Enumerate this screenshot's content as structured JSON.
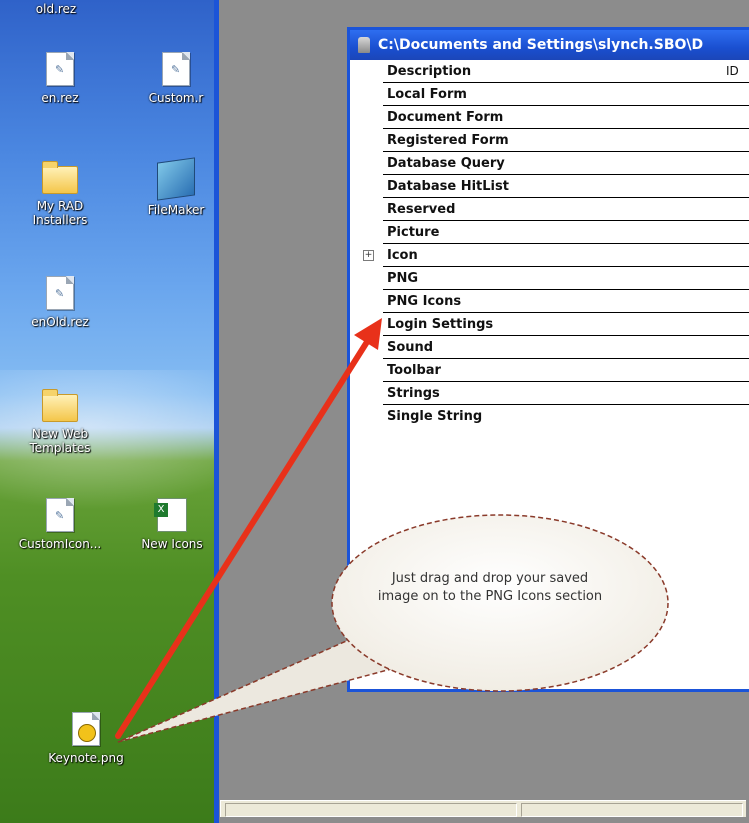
{
  "desktop": {
    "icons": [
      {
        "label": "old.rez",
        "type": "file"
      },
      {
        "label": "en.rez",
        "type": "file"
      },
      {
        "label": "Custom.r",
        "type": "file"
      },
      {
        "label": "My RAD\nInstallers",
        "type": "folder"
      },
      {
        "label": "FileMaker",
        "type": "shortcut"
      },
      {
        "label": "enOld.rez",
        "type": "file"
      },
      {
        "label": "New Web\nTemplates",
        "type": "folder"
      },
      {
        "label": "CustomIcon...",
        "type": "file"
      },
      {
        "label": "New Icons",
        "type": "excel"
      },
      {
        "label": "Keynote.png",
        "type": "png"
      }
    ]
  },
  "window": {
    "title": "C:\\Documents and Settings\\slynch.SBO\\D",
    "columns": {
      "description": "Description",
      "id": "ID"
    },
    "rows": [
      {
        "label": "Local Form"
      },
      {
        "label": "Document Form"
      },
      {
        "label": "Registered Form"
      },
      {
        "label": "Database Query"
      },
      {
        "label": "Database HitList"
      },
      {
        "label": "Reserved"
      },
      {
        "label": "Picture"
      },
      {
        "label": "Icon",
        "expandable": true,
        "expander": "+"
      },
      {
        "label": "PNG"
      },
      {
        "label": "PNG Icons"
      },
      {
        "label": "Login Settings"
      },
      {
        "label": "Sound"
      },
      {
        "label": "Toolbar"
      },
      {
        "label": "Strings"
      },
      {
        "label": "Single String"
      }
    ]
  },
  "annotation": {
    "text": "Just drag and drop your saved image on to the PNG Icons section",
    "arrow_color": "#e8311a",
    "bubble_border": "#8a3a2a"
  }
}
